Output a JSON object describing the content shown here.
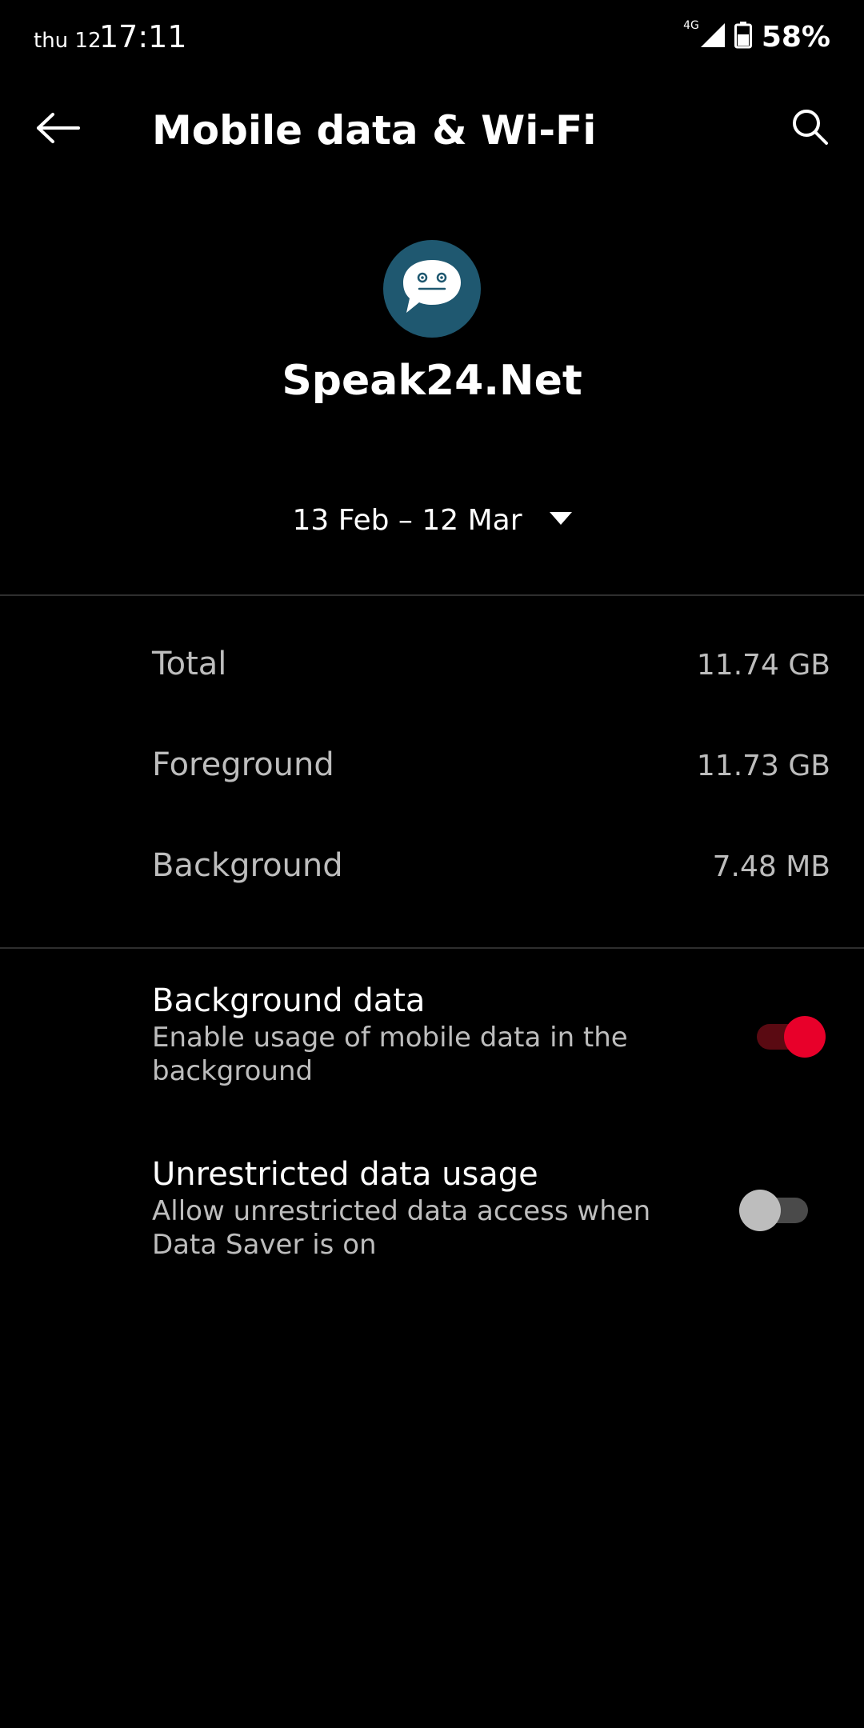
{
  "status_bar": {
    "date": "thu 12",
    "time": "17:11",
    "network": "4G",
    "battery": "58%"
  },
  "toolbar": {
    "title": "Mobile data & Wi-Fi",
    "back_icon": "back-arrow-icon",
    "search_icon": "search-icon"
  },
  "app": {
    "name": "Speak24.Net",
    "icon": "chat-bubble-icon",
    "icon_color": "#1f5870"
  },
  "period": {
    "label": "13 Feb – 12 Mar"
  },
  "usage": [
    {
      "label": "Total",
      "value": "11.74 GB"
    },
    {
      "label": "Foreground",
      "value": "11.73 GB"
    },
    {
      "label": "Background",
      "value": "7.48 MB"
    }
  ],
  "settings": [
    {
      "title": "Background data",
      "subtitle": "Enable usage of mobile data in the background",
      "enabled": true
    },
    {
      "title": "Unrestricted data usage",
      "subtitle": "Allow unrestricted data access when Data Saver is on",
      "enabled": false
    }
  ],
  "accent_color": "#e8002a"
}
